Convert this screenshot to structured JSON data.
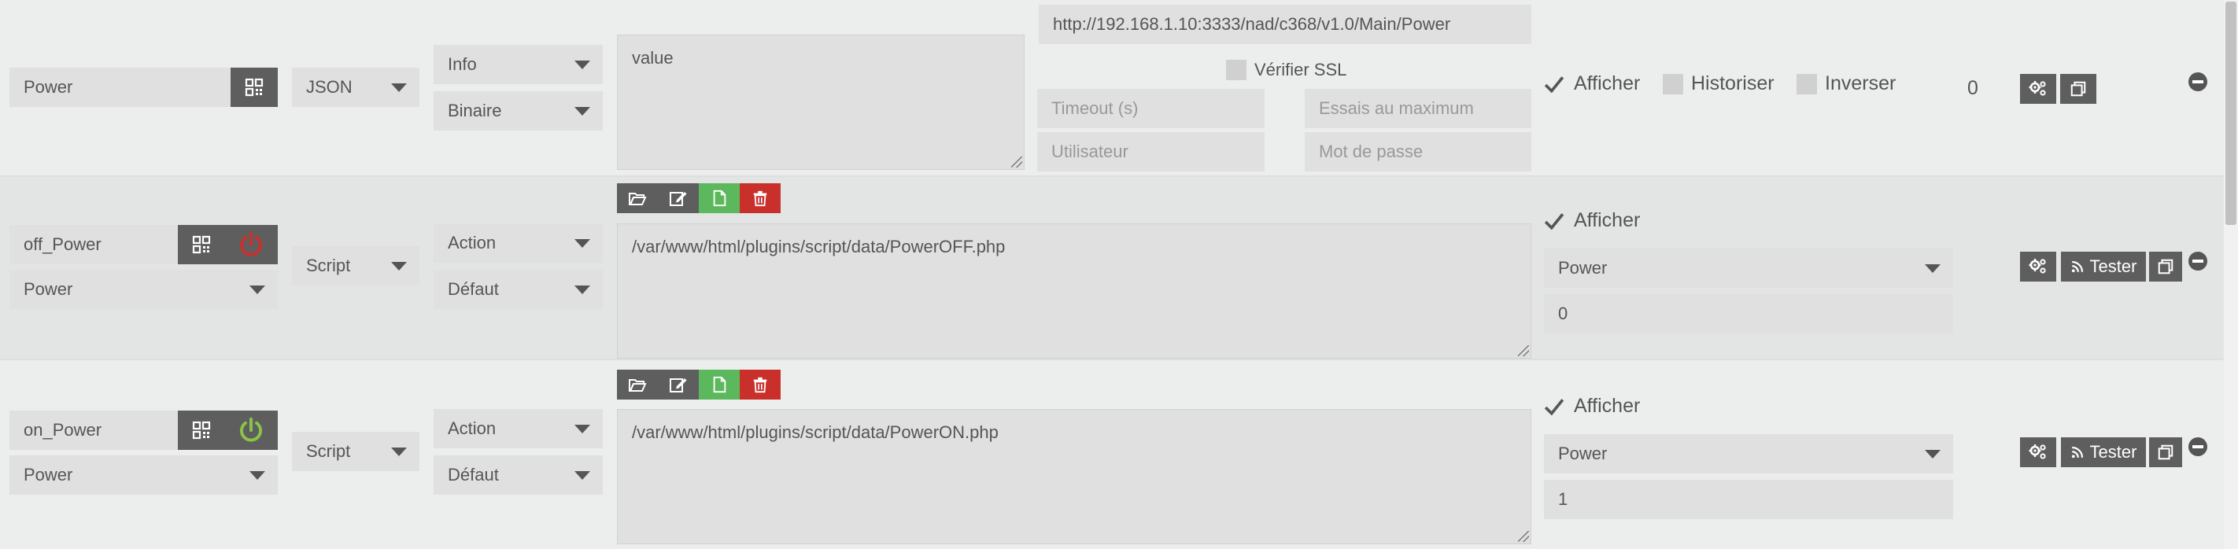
{
  "rows": [
    {
      "name": "Power",
      "type": "JSON",
      "subtype": "Info",
      "format": "Binaire",
      "request": "value",
      "url": "http://192.168.1.10:3333/nad/c368/v1.0/Main/Power",
      "verify_ssl_label": "Vérifier SSL",
      "timeout_placeholder": "Timeout (s)",
      "retries_placeholder": "Essais au maximum",
      "user_placeholder": "Utilisateur",
      "password_placeholder": "Mot de passe",
      "afficher_label": "Afficher",
      "historiser_label": "Historiser",
      "inverser_label": "Inverser",
      "value": "0"
    },
    {
      "name": "off_Power",
      "linked_info": "Power",
      "type": "Script",
      "subtype": "Action",
      "subtype2": "Défaut",
      "script_path": "/var/www/html/plugins/script/data/PowerOFF.php",
      "afficher_label": "Afficher",
      "update_cmd": "Power",
      "update_value": "0",
      "test_label": "Tester",
      "power_icon_color": "#c9302c"
    },
    {
      "name": "on_Power",
      "linked_info": "Power",
      "type": "Script",
      "subtype": "Action",
      "subtype2": "Défaut",
      "script_path": "/var/www/html/plugins/script/data/PowerON.php",
      "afficher_label": "Afficher",
      "update_cmd": "Power",
      "update_value": "1",
      "test_label": "Tester",
      "power_icon_color": "#8bc34a"
    }
  ],
  "icons": {
    "config": "gears-icon",
    "copy": "copy-icon",
    "remove": "minus-circle-icon",
    "tester": "rss-icon",
    "folder": "folder-open-icon",
    "edit": "edit-icon",
    "new": "file-icon",
    "delete": "trash-icon"
  }
}
